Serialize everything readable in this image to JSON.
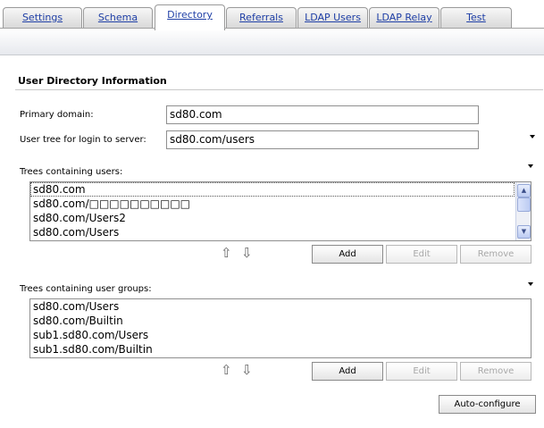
{
  "tabs": [
    {
      "label": "Settings",
      "active": false
    },
    {
      "label": "Schema",
      "active": false
    },
    {
      "label": "Directory",
      "active": true
    },
    {
      "label": "Referrals",
      "active": false
    },
    {
      "label": "LDAP Users",
      "active": false
    },
    {
      "label": "LDAP Relay",
      "active": false
    },
    {
      "label": "Test",
      "active": false
    }
  ],
  "section": {
    "title": "User Directory Information"
  },
  "primary_domain": {
    "label": "Primary domain:",
    "value": "sd80.com"
  },
  "user_tree": {
    "label": "User tree for login to server:",
    "value": "sd80.com/users"
  },
  "user_trees": {
    "label": "Trees containing users:",
    "items": [
      "sd80.com",
      "sd80.com/□□□□□□□□□□",
      "sd80.com/Users2",
      "sd80.com/Users"
    ],
    "selected": "sd80.com"
  },
  "group_trees": {
    "label": "Trees containing user groups:",
    "items": [
      "sd80.com/Users",
      "sd80.com/Builtin",
      "sub1.sd80.com/Users",
      "sub1.sd80.com/Builtin"
    ]
  },
  "buttons": {
    "add": "Add",
    "edit": "Edit",
    "remove": "Remove",
    "auto_configure": "Auto-configure"
  },
  "icons": {
    "move_up": "⇧",
    "move_down": "⇩",
    "scroll_up": "▲",
    "scroll_down": "▼"
  }
}
